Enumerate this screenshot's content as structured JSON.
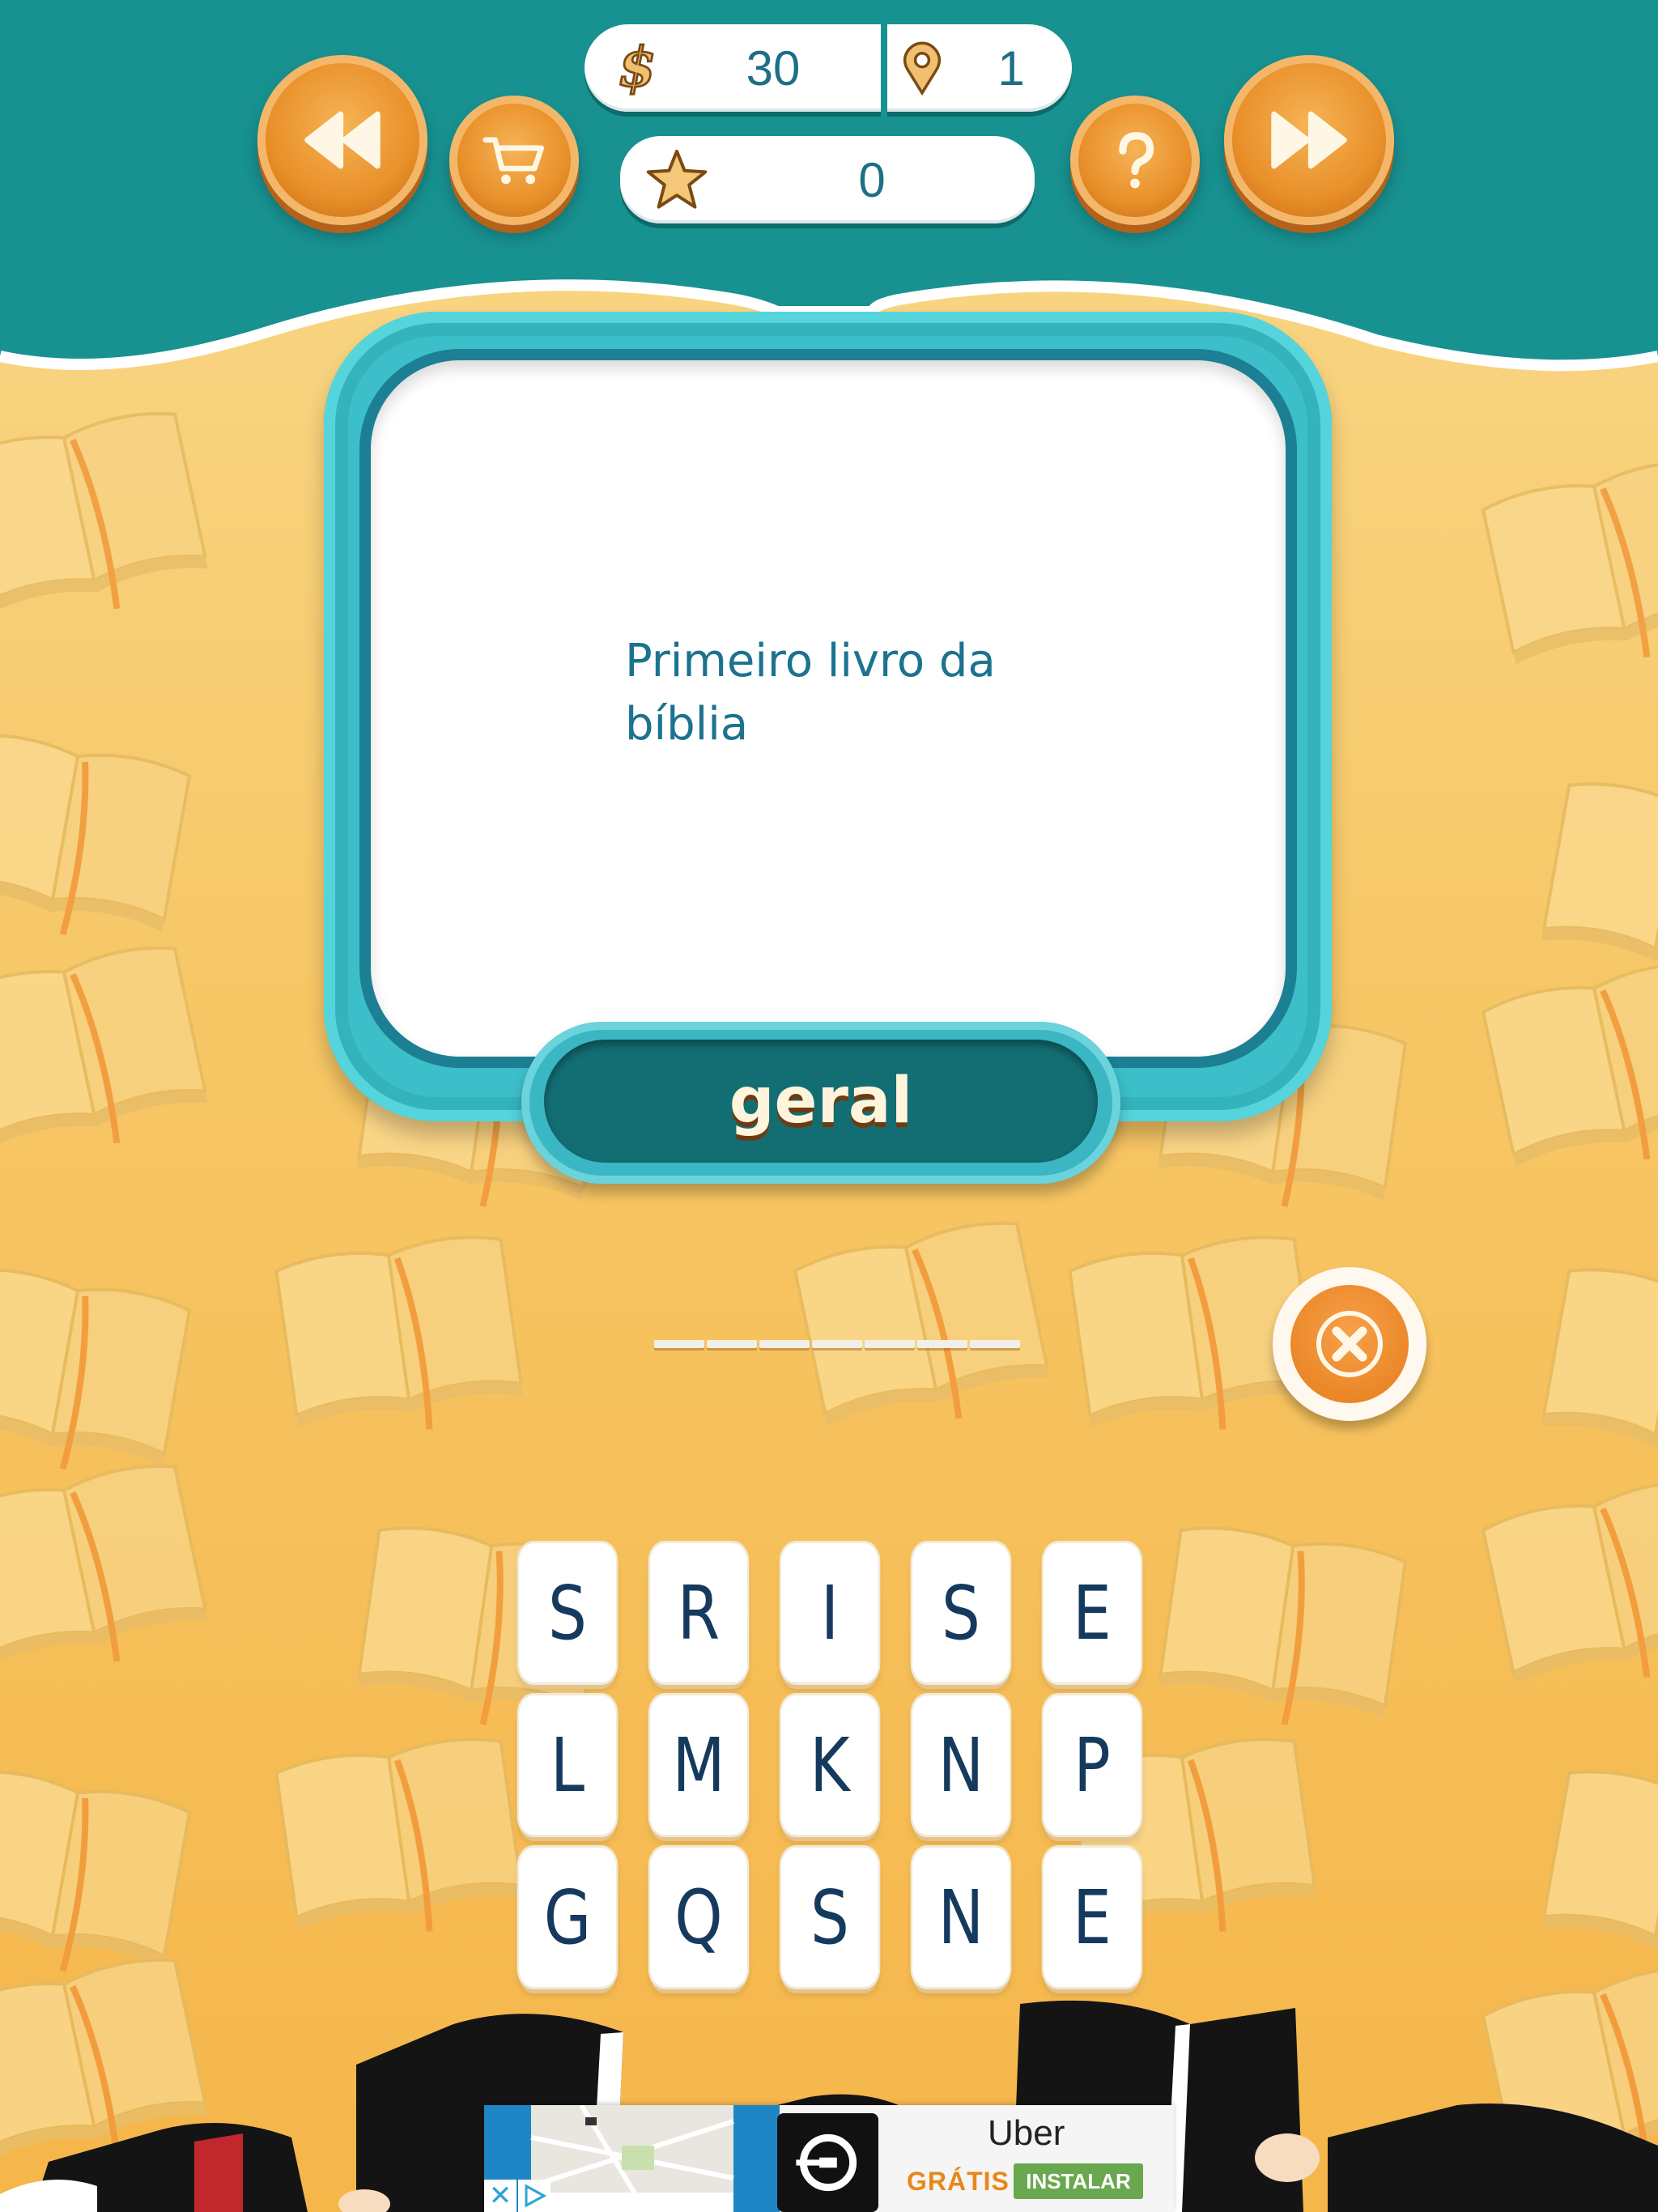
{
  "header": {
    "coins": "30",
    "level": "1",
    "stars": "0"
  },
  "question": {
    "text": "Primeiro livro da bíblia",
    "category": "geral"
  },
  "answer": {
    "slot_count": 7
  },
  "letters": [
    "S",
    "R",
    "I",
    "S",
    "E",
    "L",
    "M",
    "K",
    "N",
    "P",
    "G",
    "Q",
    "S",
    "N",
    "E"
  ],
  "ad": {
    "title": "Uber",
    "free_label": "GRÁTIS",
    "install_label": "INSTALAR"
  },
  "colors": {
    "header_teal": "#189191",
    "button_orange": "#e9902a",
    "tile_text": "#16395e",
    "question_text": "#1b7390"
  }
}
